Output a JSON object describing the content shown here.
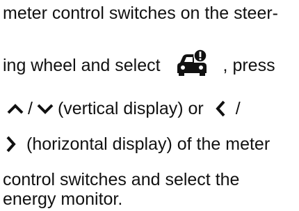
{
  "document": {
    "line1": "meter control switches on the steer-",
    "line2_a": "ing wheel and select",
    "line2_b": ", press",
    "line3_sep1": "/",
    "line3_mid": "(vertical display) or",
    "line3_sep2": "/",
    "line4_text": "(horizontal display) of the meter",
    "line5": "control switches and select the",
    "line6": "energy monitor."
  },
  "icons": {
    "vehicle_info": "car-info-icon",
    "up": "chevron-up-icon",
    "down": "chevron-down-icon",
    "left": "chevron-left-icon",
    "right": "chevron-right-icon"
  }
}
